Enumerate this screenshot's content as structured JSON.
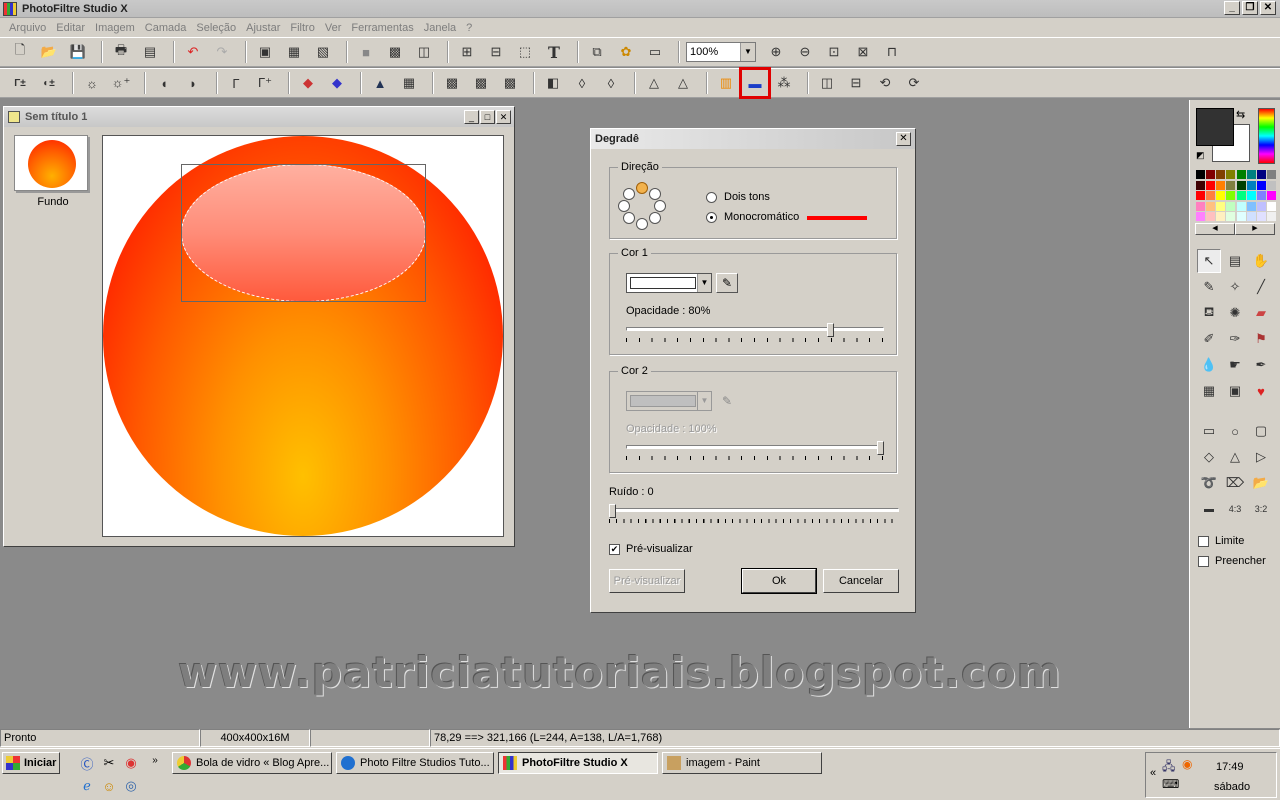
{
  "app": {
    "title": "PhotoFiltre Studio X"
  },
  "menu": [
    "Arquivo",
    "Editar",
    "Imagem",
    "Camada",
    "Seleção",
    "Ajustar",
    "Filtro",
    "Ver",
    "Ferramentas",
    "Janela",
    "?"
  ],
  "toolbar1": {
    "zoom_value": "100%",
    "text_tool_glyph": "T"
  },
  "document": {
    "title": "Sem título 1",
    "layer_name": "Fundo"
  },
  "dialog": {
    "title": "Degradê",
    "direction_label": "Direção",
    "option_two_tones": "Dois tons",
    "option_mono": "Monocromático",
    "mono_color": "#ff0000",
    "color1_label": "Cor 1",
    "color1_value": "#ffffff",
    "opacity1_label": "Opacidade : 80%",
    "opacity1_value": 80,
    "color2_label": "Cor 2",
    "opacity2_label": "Opacidade : 100%",
    "opacity2_value": 100,
    "noise_label": "Ruído : 0",
    "noise_value": 0,
    "preview_check_label": "Pré-visualizar",
    "preview_button": "Pré-visualizar",
    "ok_button": "Ok",
    "cancel_button": "Cancelar"
  },
  "watermark": "www.patriciatutoriais.blogspot.com",
  "right_panel": {
    "fg_color": "#323232",
    "bg_color": "#ffffff",
    "limit_label": "Limite",
    "fill_label": "Preencher"
  },
  "status": {
    "ready": "Pronto",
    "size": "400x400x16M",
    "coords": "78,29 ==> 321,166 (L=244, A=138, L/A=1,768)"
  },
  "taskbar": {
    "start_label": "Iniciar",
    "tasks": [
      "Bola de vidro « Blog Apre...",
      "Photo Filtre Studios Tuto...",
      "PhotoFiltre Studio X",
      "imagem - Paint"
    ],
    "time": "17:49",
    "day": "sábado"
  }
}
